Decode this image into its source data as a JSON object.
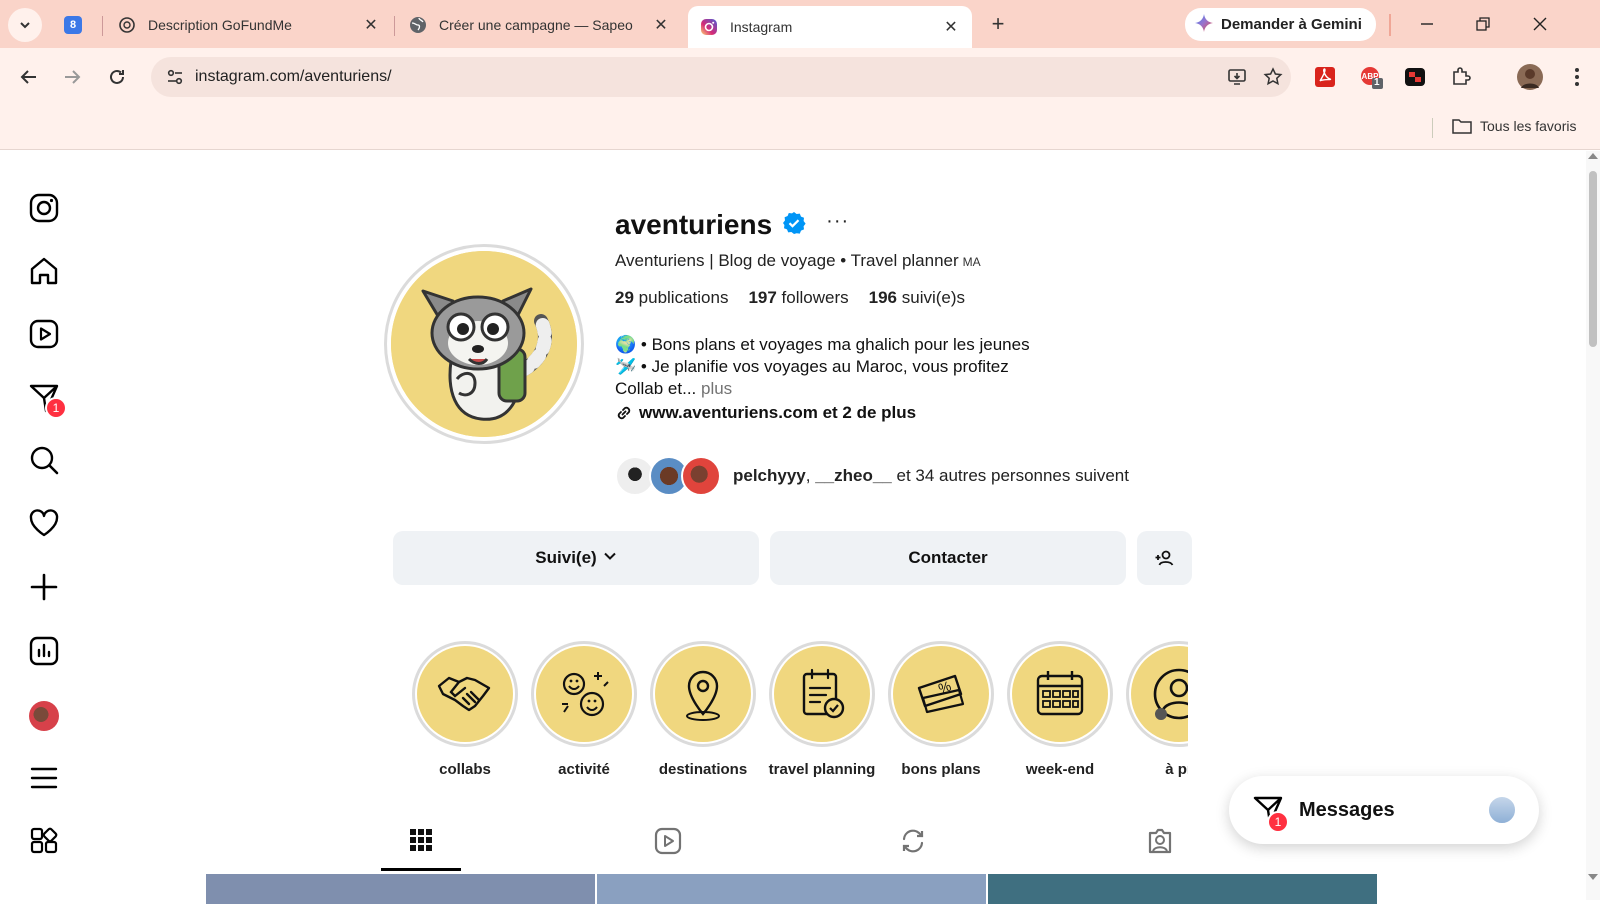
{
  "browser": {
    "tabs": [
      {
        "title": "Description GoFundMe",
        "favicon": "openai-icon"
      },
      {
        "title": "Créer une campagne — Sapeo",
        "favicon": "globe-icon"
      },
      {
        "title": "Instagram",
        "favicon": "instagram-icon",
        "active": true
      }
    ],
    "pinned_tab_label": "8",
    "gemini_label": "Demander à Gemini",
    "url": "instagram.com/aventuriens/",
    "extension_badge": "1",
    "bookmarks_label": "Tous les favoris"
  },
  "sidebar": {
    "notifications_badge": "1",
    "items": [
      "instagram-logo",
      "home",
      "reels",
      "messages",
      "search",
      "notifications",
      "create",
      "dashboard",
      "profile",
      "more",
      "also-from-meta"
    ]
  },
  "profile": {
    "username": "aventuriens",
    "more_label": "···",
    "full_name": "Aventuriens | Blog de voyage • Travel planner",
    "pronoun_tag": "MA",
    "stats": {
      "posts_count": "29",
      "posts_label": "publications",
      "followers_count": "197",
      "followers_label": "followers",
      "following_count": "196",
      "following_label": "suivi(e)s"
    },
    "bio_line1": "🌍 • Bons plans et voyages ma ghalich pour les jeunes",
    "bio_line2": "🛩️ • Je planifie vos voyages au Maroc, vous profitez",
    "bio_line3": "Collab et...",
    "bio_more": "plus",
    "link": "www.aventuriens.com et 2 de plus",
    "mutual_user1": "pelchyyy",
    "mutual_sep": ", ",
    "mutual_user2": "__zheo__",
    "mutual_rest": " et 34 autres personnes suivent"
  },
  "actions": {
    "following_label": "Suivi(e)",
    "contact_label": "Contacter"
  },
  "highlights": [
    {
      "label": "collabs",
      "icon": "handshake-icon"
    },
    {
      "label": "activité",
      "icon": "smileys-icon"
    },
    {
      "label": "destinations",
      "icon": "location-pin-icon"
    },
    {
      "label": "travel planning",
      "icon": "clipboard-check-icon"
    },
    {
      "label": "bons plans",
      "icon": "discount-tickets-icon"
    },
    {
      "label": "week-end",
      "icon": "calendar-icon"
    },
    {
      "label": "à pr",
      "icon": "person-icon"
    }
  ],
  "messages_bar": {
    "label": "Messages",
    "badge": "1"
  },
  "colors": {
    "tabbar": "#fad4c9",
    "toolbar": "#fff1ec",
    "highlight_fill": "#f0d77f",
    "verified": "#0095f6",
    "badge": "#ff3040",
    "button_bg": "#eff2f5"
  }
}
